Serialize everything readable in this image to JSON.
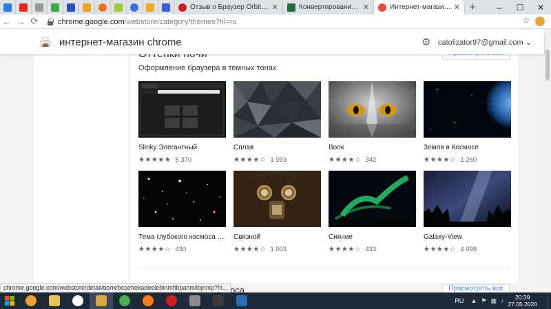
{
  "tabs": {
    "pinned": [
      {
        "icon": "download-icon",
        "color": "#2f7de1"
      },
      {
        "icon": "youtube-icon",
        "color": "#e02a20"
      },
      {
        "icon": "back-arrow-icon",
        "color": "#666666"
      },
      {
        "icon": "green-app-icon",
        "color": "#39a845"
      },
      {
        "icon": "blue-app-icon",
        "color": "#2a4fb8"
      },
      {
        "icon": "chart-icon",
        "color": "#f0a020"
      },
      {
        "icon": "orange-app-icon",
        "color": "#f37021"
      },
      {
        "icon": "android-icon",
        "color": "#9acd32"
      },
      {
        "icon": "blue-circle-icon",
        "color": "#3b6fd6"
      },
      {
        "icon": "orange-bar-icon",
        "color": "#f5a623"
      },
      {
        "icon": "blue-square-icon",
        "color": "#3b5bdb"
      }
    ],
    "open": [
      {
        "title": "Отзыв о Браузер Orbitum | Б",
        "icon": "opera-icon",
        "color": "#cc1f1f"
      },
      {
        "title": "Конвертирование изображ",
        "icon": "excel-icon",
        "color": "#1e7145"
      },
      {
        "title": "Интернет-магазин Chrome",
        "icon": "webstore-icon",
        "color": "#e94b3c",
        "active": true
      }
    ]
  },
  "toolbar": {
    "url_host": "chrome.google.com",
    "url_path": "/webstore/category/themes?hl=ru"
  },
  "store": {
    "title": "интернет-магазин chrome",
    "account": "catolizator97@gmail.com"
  },
  "section": {
    "title_partial": "Оттенки ночи",
    "subtitle": "Оформление браузера в темных тонах",
    "see_all": "Просмотреть все"
  },
  "themes": [
    {
      "name": "Slinky Элегантный",
      "stars": "★★★★★",
      "count": "5 370"
    },
    {
      "name": "Сплав",
      "stars": "★★★★☆",
      "count": "1 093"
    },
    {
      "name": "Волк",
      "stars": "★★★★☆",
      "count": "342"
    },
    {
      "name": "Земля в Космосе",
      "stars": "★★★★☆",
      "count": "1 260"
    },
    {
      "name": "Тема глубокого космоса в че...",
      "stars": "★★★★☆",
      "count": "430"
    },
    {
      "name": "Связной",
      "stars": "★★★★☆",
      "count": "1 003"
    },
    {
      "name": "Сияние",
      "stars": "★★★★☆",
      "count": "433"
    },
    {
      "name": "Galaxy-View",
      "stars": "★★★★☆",
      "count": "4 098"
    }
  ],
  "section2": {
    "title_partial": "зание космоса",
    "see_all": "Просмотреть все"
  },
  "status_url": "chrome.google.com/webstore/detail/волк/bccehekadeelebinmfibpahmllbjnnip?hl...",
  "taskbar": {
    "lang": "RU",
    "time": "20:39",
    "date": "27.05.2020",
    "apps": [
      {
        "icon": "media-player-icon",
        "color": "#f0a030"
      },
      {
        "icon": "folder-icon",
        "color": "#e8c35a"
      },
      {
        "icon": "yandex-icon",
        "color": "#ffffff"
      },
      {
        "icon": "photo-app-icon",
        "color": "#d9a441"
      },
      {
        "icon": "chrome-icon",
        "color": "#4caf50"
      },
      {
        "icon": "firefox-icon",
        "color": "#ff7a1a"
      },
      {
        "icon": "opera-icon",
        "color": "#cc1f1f"
      },
      {
        "icon": "app-icon",
        "color": "#8a8a8a"
      },
      {
        "icon": "nox-icon",
        "color": "#3b3b3b"
      },
      {
        "icon": "gear-app-icon",
        "color": "#2b6cb0"
      }
    ]
  }
}
